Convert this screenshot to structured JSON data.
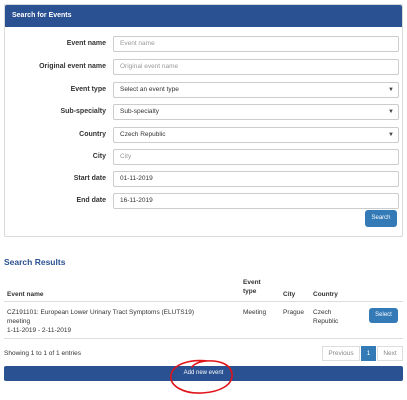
{
  "search_panel": {
    "title": "Search for Events",
    "fields": {
      "event_name": {
        "label": "Event name",
        "placeholder": "Event name"
      },
      "original_event_name": {
        "label": "Original event name",
        "placeholder": "Original event name"
      },
      "event_type": {
        "label": "Event type",
        "value": "Select an event type"
      },
      "sub_specialty": {
        "label": "Sub-specialty",
        "value": "Sub-specialty"
      },
      "country": {
        "label": "Country",
        "value": "Czech Republic"
      },
      "city": {
        "label": "City",
        "placeholder": "City"
      },
      "start_date": {
        "label": "Start date",
        "value": "01-11-2019"
      },
      "end_date": {
        "label": "End date",
        "value": "16-11-2019"
      }
    },
    "search_button": "Search"
  },
  "results": {
    "title": "Search Results",
    "headers": {
      "event_name": "Event name",
      "event_type_line1": "Event",
      "event_type_line2": "type",
      "city": "City",
      "country": "Country"
    },
    "rows": [
      {
        "event_name_line1": "CZ191101: European Lower Urinary Tract Symptoms (ELUTS19)",
        "event_name_line2": "meeting",
        "dates": "1-11-2019 - 2-11-2019",
        "event_type": "Meeting",
        "city": "Prague",
        "country_line1": "Czech",
        "country_line2": "Republic",
        "select_label": "Select"
      }
    ],
    "info": "Showing 1 to 1 of 1 entries",
    "pagination": {
      "previous": "Previous",
      "current": "1",
      "next": "Next"
    },
    "add_button": "Add new event"
  },
  "colors": {
    "header_blue": "#2a5192",
    "button_blue": "#337ab7",
    "annotation_red": "#e0151b"
  }
}
